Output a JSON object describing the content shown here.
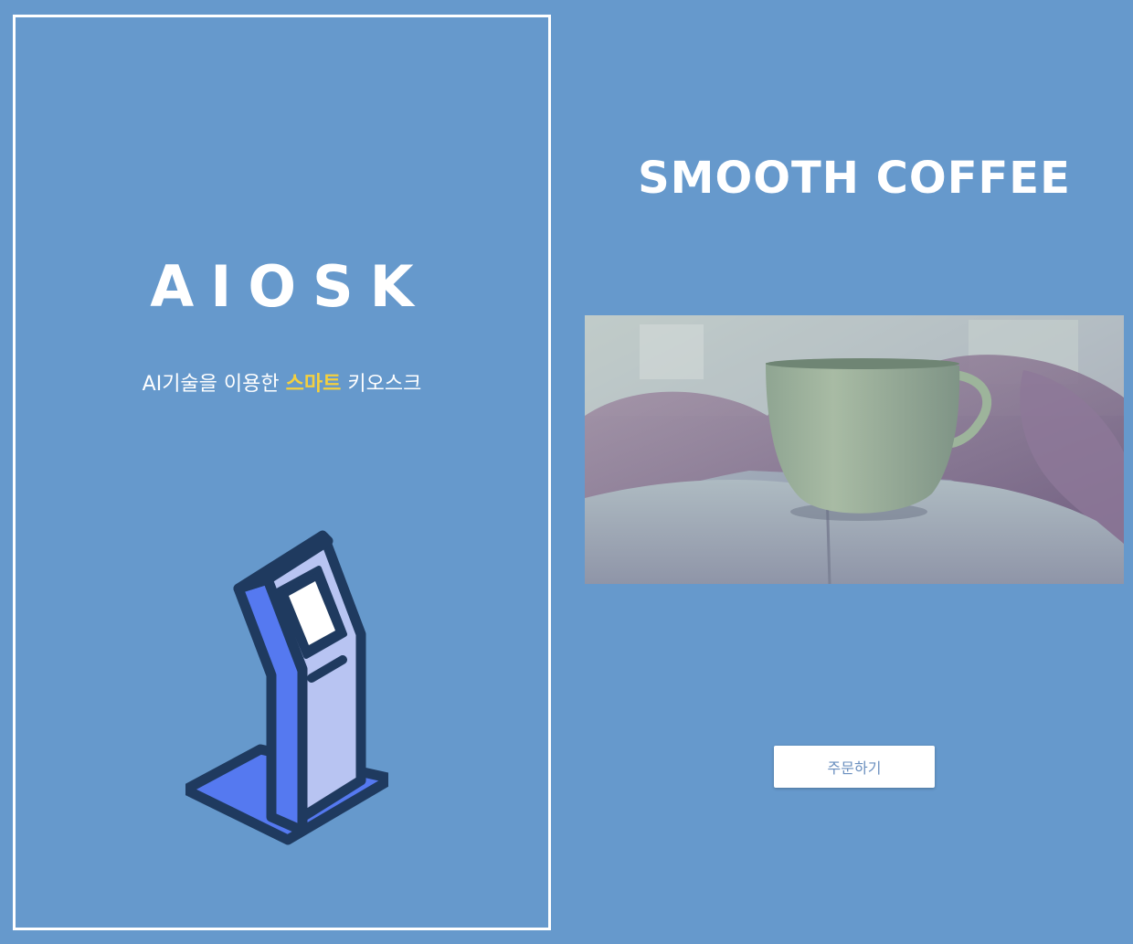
{
  "left": {
    "brand": "AIOSK",
    "tagline_prefix": "AI기술을 이용한 ",
    "tagline_highlight": "스마트",
    "tagline_suffix": " 키오스크"
  },
  "right": {
    "title": "SMOOTH COFFEE",
    "order_label": "주문하기"
  },
  "colors": {
    "background": "#6699cc",
    "highlight": "#f4d03f",
    "kiosk_body": "#b8c4f2",
    "kiosk_side": "#5579f0",
    "kiosk_outline": "#1f3a5f"
  },
  "icons": {
    "kiosk": "kiosk-icon"
  }
}
